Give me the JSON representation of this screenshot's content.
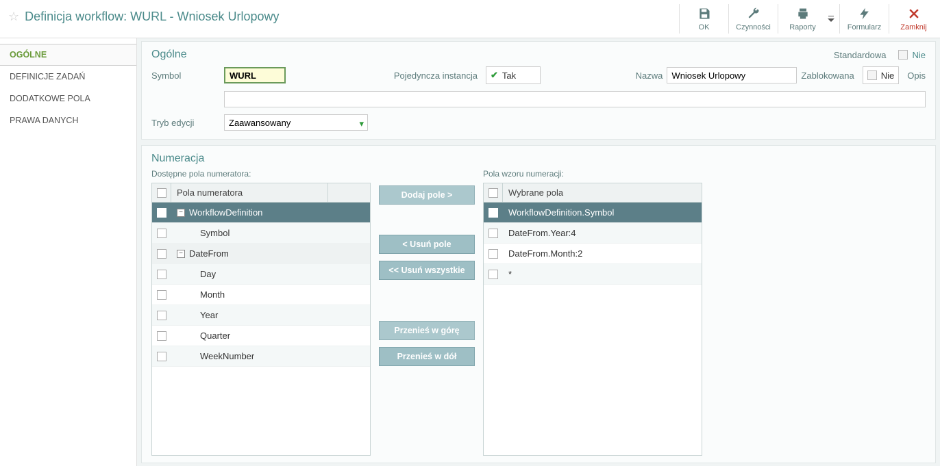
{
  "header": {
    "title": "Definicja workflow: WURL - Wniosek Urlopowy"
  },
  "toolbar": {
    "ok": "OK",
    "actions": "Czynności",
    "reports": "Raporty",
    "form": "Formularz",
    "close": "Zamknij"
  },
  "sidebar": {
    "items": [
      {
        "label": "OGÓLNE"
      },
      {
        "label": "DEFINICJE ZADAŃ"
      },
      {
        "label": "DODATKOWE POLA"
      },
      {
        "label": "PRAWA DANYCH"
      }
    ]
  },
  "general": {
    "panel_title": "Ogólne",
    "right_std": "Standardowa",
    "right_nie": "Nie",
    "symbol_lbl": "Symbol",
    "symbol_val": "WURL",
    "single_lbl": "Pojedyncza instancja",
    "single_val": "Tak",
    "name_lbl": "Nazwa",
    "name_val": "Wniosek Urlopowy",
    "locked_lbl": "Zablokowana",
    "locked_val": "Nie",
    "desc_lbl": "Opis",
    "desc_val": "",
    "mode_lbl": "Tryb edycji",
    "mode_val": "Zaawansowany"
  },
  "numbering": {
    "panel_title": "Numeracja",
    "left_title": "Dostępne pola numeratora:",
    "right_title": "Pola wzoru numeracji:",
    "left_header": "Pola numeratora",
    "right_header": "Wybrane pola",
    "left_rows": [
      {
        "label": "WorkflowDefinition",
        "lvl": 1,
        "exp": true,
        "sel": true
      },
      {
        "label": "Symbol",
        "lvl": 2,
        "alt": true
      },
      {
        "label": "DateFrom",
        "lvl": 1,
        "exp": true,
        "alt": false
      },
      {
        "label": "Day",
        "lvl": 2,
        "alt": true
      },
      {
        "label": "Month",
        "lvl": 2,
        "alt": false
      },
      {
        "label": "Year",
        "lvl": 2,
        "alt": true
      },
      {
        "label": "Quarter",
        "lvl": 2,
        "alt": false
      },
      {
        "label": "WeekNumber",
        "lvl": 2,
        "alt": true
      }
    ],
    "right_rows": [
      {
        "label": "WorkflowDefinition.Symbol",
        "sel": true
      },
      {
        "label": "DateFrom.Year:4",
        "alt": true
      },
      {
        "label": "DateFrom.Month:2"
      },
      {
        "label": "*",
        "alt": true
      }
    ],
    "buttons": {
      "add": "Dodaj pole >",
      "del": "< Usuń pole",
      "del_all": "<< Usuń wszystkie",
      "up": "Przenieś w górę",
      "down": "Przenieś w dół"
    }
  }
}
